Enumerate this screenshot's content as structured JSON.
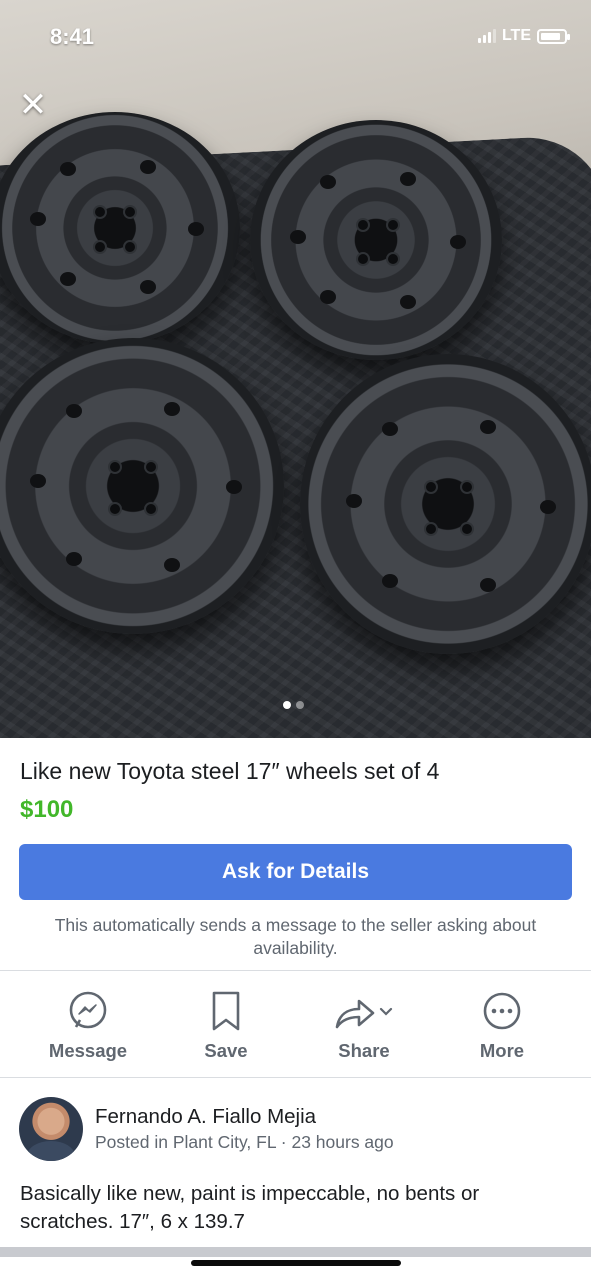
{
  "status_bar": {
    "time": "8:41",
    "network": "LTE"
  },
  "photo": {
    "carousel_count": 2,
    "active_index": 0
  },
  "listing": {
    "title": "Like new Toyota steel 17″ wheels set of 4",
    "price": "$100",
    "cta_label": "Ask for Details",
    "cta_note": "This automatically sends a message to the seller asking about availability."
  },
  "actions": [
    {
      "label": "Message",
      "icon": "messenger-icon"
    },
    {
      "label": "Save",
      "icon": "bookmark-icon"
    },
    {
      "label": "Share",
      "icon": "share-icon"
    },
    {
      "label": "More",
      "icon": "more-icon"
    }
  ],
  "seller": {
    "name": "Fernando A. Fiallo Mejia",
    "meta": "Posted in Plant City, FL · 23 hours ago"
  },
  "description": "Basically like new, paint is impeccable, no bents or scratches. 17″, 6 x 139.7",
  "colors": {
    "accent": "#4a7ae0",
    "price": "#42b72a",
    "secondary_text": "#606770"
  }
}
